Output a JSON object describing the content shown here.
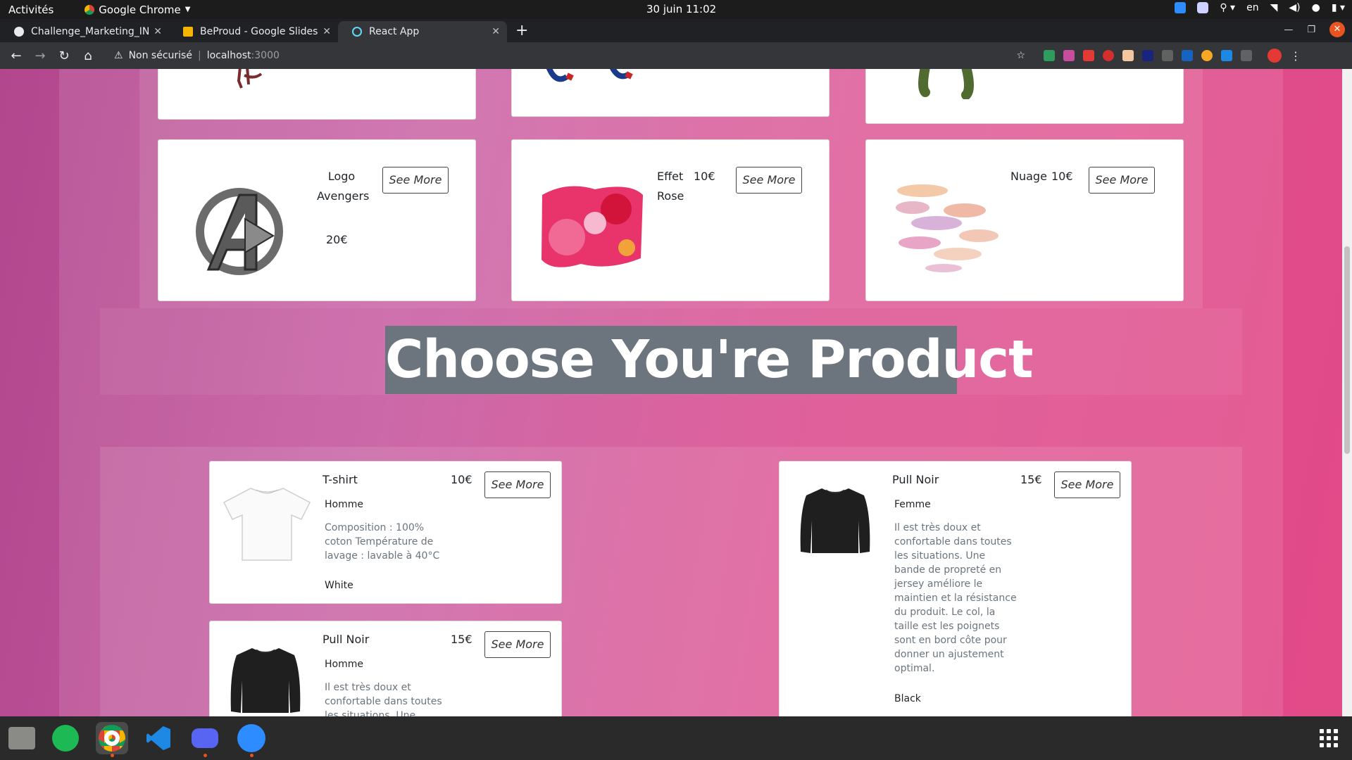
{
  "topbar": {
    "activities": "Activités",
    "app": "Google Chrome",
    "clock": "30 juin  11:02",
    "lang": "en"
  },
  "tabs": [
    {
      "title": "Challenge_Marketing_INS",
      "favicon": "globe-icon",
      "color": "#e8eaed"
    },
    {
      "title": "BeProud - Google Slides",
      "favicon": "slides-icon",
      "color": "#f4b400"
    },
    {
      "title": "React App",
      "favicon": "react-icon",
      "color": "#61dafb"
    }
  ],
  "omnibox": {
    "security": "Non sécurisé",
    "host": "localhost",
    "port": ":3000"
  },
  "top_cards": [
    {
      "name": "Logo\nAvengers",
      "price": "20€",
      "button": "See More"
    },
    {
      "name": "Effet\nRose",
      "price": "10€",
      "button": "See More"
    },
    {
      "name": "Nuage",
      "price": "10€",
      "button": "See More"
    }
  ],
  "heading": "Choose You're Product",
  "products": [
    {
      "name": "T-shirt",
      "price": "10€",
      "gender": "Homme",
      "description": "Composition : 100% coton Température de lavage : lavable à 40°C",
      "color": "White",
      "button": "See More"
    },
    {
      "name": "Pull Noir",
      "price": "15€",
      "gender": "Femme",
      "description": "Il est très doux et confortable dans toutes les situations. Une bande de propreté en jersey améliore le maintien et la résistance du produit. Le col, la taille est les poignets sont en bord côte pour donner un ajustement optimal.",
      "color": "Black",
      "button": "See More"
    },
    {
      "name": "Pull Noir",
      "price": "15€",
      "gender": "Homme",
      "description": "Il est très doux et confortable dans toutes les situations. Une",
      "color": "",
      "button": "See More"
    }
  ],
  "colors": {
    "accent": "#e95420",
    "heading_bg": "#6c757d",
    "page_pink": "#dc4f90"
  }
}
